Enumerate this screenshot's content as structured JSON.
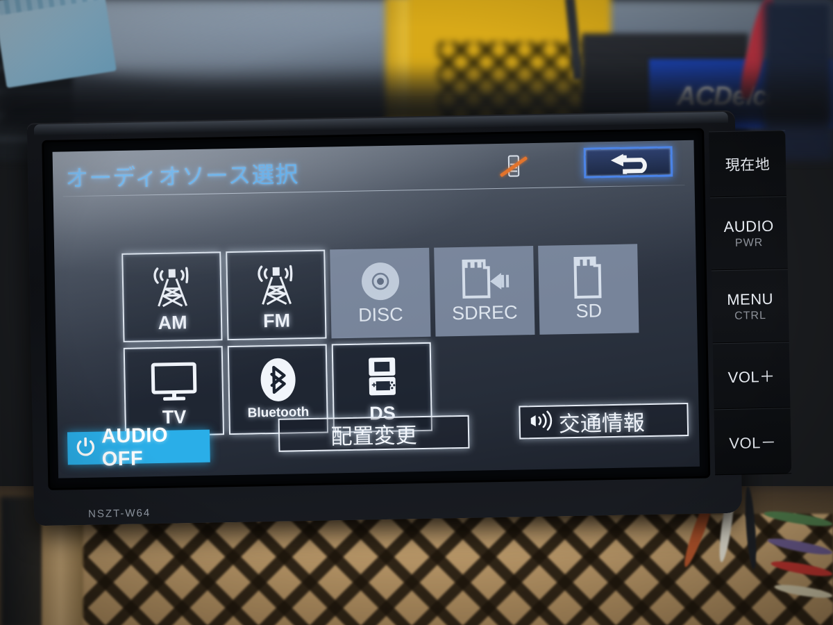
{
  "photo": {
    "background_objects": [
      "ACDelco"
    ],
    "acdelco_text": "ACDelco"
  },
  "device": {
    "model_label": "NSZT-W64"
  },
  "screen": {
    "title": "オーディオソース選択",
    "status_icon": "no-phone-icon",
    "back_button_icon": "back-arrow-icon"
  },
  "sources": [
    {
      "id": "am",
      "label": "AM",
      "icon": "radio-tower-icon",
      "state": "active",
      "label_size": "normal"
    },
    {
      "id": "fm",
      "label": "FM",
      "icon": "radio-tower-icon",
      "state": "active",
      "label_size": "normal"
    },
    {
      "id": "disc",
      "label": "DISC",
      "icon": "disc-icon",
      "state": "disabled",
      "label_size": "normal"
    },
    {
      "id": "sdrec",
      "label": "SDREC",
      "icon": "sd-record-icon",
      "state": "disabled",
      "label_size": "normal"
    },
    {
      "id": "sd",
      "label": "SD",
      "icon": "sd-card-icon",
      "state": "disabled",
      "label_size": "normal"
    },
    {
      "id": "tv",
      "label": "TV",
      "icon": "tv-icon",
      "state": "active",
      "label_size": "normal"
    },
    {
      "id": "bluetooth",
      "label": "Bluetooth",
      "icon": "bluetooth-icon",
      "state": "active",
      "label_size": "small"
    },
    {
      "id": "ds",
      "label": "DS",
      "icon": "nintendo-ds-icon",
      "state": "active",
      "label_size": "normal"
    }
  ],
  "bottom_bar": {
    "audio_off_label": "AUDIO OFF",
    "audio_off_icon": "power-icon",
    "rearrange_label": "配置変更",
    "traffic_label": "交通情報",
    "traffic_icon": "broadcast-icon"
  },
  "hard_keys": [
    {
      "primary": "現在地",
      "secondary": "",
      "jp": true
    },
    {
      "primary": "AUDIO",
      "secondary": "PWR",
      "jp": false
    },
    {
      "primary": "MENU",
      "secondary": "CTRL",
      "jp": false
    },
    {
      "primary": "VOL＋",
      "secondary": "",
      "jp": false
    },
    {
      "primary": "VOL－",
      "secondary": "",
      "jp": false
    }
  ],
  "colors": {
    "title_blue": "#3aa2f2",
    "audio_off_cyan": "#2aaee8",
    "back_border_blue": "#3f7ff0",
    "disabled_gray": "#77849a",
    "active_white": "#e6edf6",
    "slash_orange": "#f06a12"
  }
}
